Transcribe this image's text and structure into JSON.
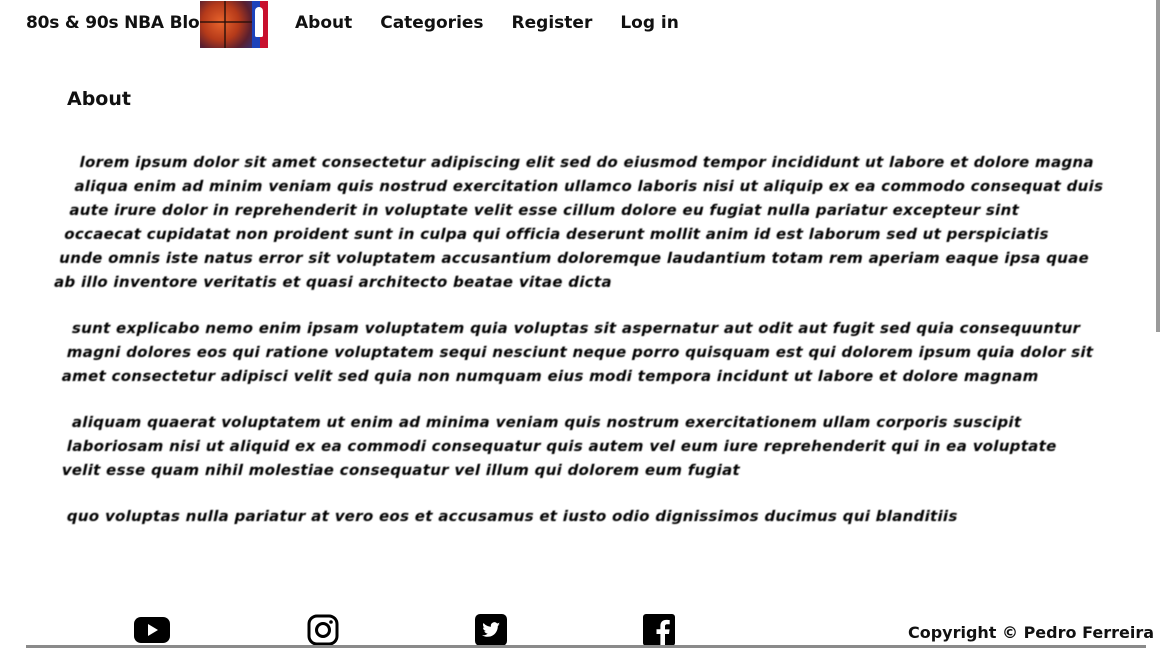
{
  "navbar": {
    "brand": "80s & 90s NBA Blog",
    "links": [
      {
        "label": "About"
      },
      {
        "label": "Categories"
      },
      {
        "label": "Register"
      },
      {
        "label": "Log in"
      }
    ]
  },
  "main": {
    "title": "About",
    "paragraphs": [
      "lorem ipsum dolor sit amet consectetur adipiscing elit sed do eiusmod tempor incididunt ut labore et dolore magna aliqua enim ad minim veniam quis nostrud exercitation ullamco laboris nisi ut aliquip ex ea commodo consequat duis aute irure dolor in reprehenderit in voluptate velit esse cillum dolore eu fugiat nulla pariatur excepteur sint occaecat cupidatat non proident sunt in culpa qui officia deserunt mollit anim id est laborum sed ut perspiciatis unde omnis iste natus error sit voluptatem accusantium doloremque laudantium totam rem aperiam eaque ipsa quae ab illo inventore veritatis et quasi architecto beatae vitae dicta",
      "sunt explicabo nemo enim ipsam voluptatem quia voluptas sit aspernatur aut odit aut fugit sed quia consequuntur magni dolores eos qui ratione voluptatem sequi nesciunt neque porro quisquam est qui dolorem ipsum quia dolor sit amet consectetur adipisci velit sed quia non numquam eius modi tempora incidunt ut labore et dolore magnam",
      "aliquam quaerat voluptatem ut enim ad minima veniam quis nostrum exercitationem ullam corporis suscipit laboriosam nisi ut aliquid ex ea commodi consequatur quis autem vel eum iure reprehenderit qui in ea voluptate velit esse quam nihil molestiae consequatur vel illum qui dolorem eum fugiat",
      "quo voluptas nulla pariatur at vero eos et accusamus et iusto odio dignissimos ducimus qui blanditiis"
    ]
  },
  "footer": {
    "icons": [
      "youtube-icon",
      "instagram-icon",
      "twitter-icon",
      "facebook-icon"
    ],
    "copyright": "Copyright © Pedro Ferreira"
  }
}
